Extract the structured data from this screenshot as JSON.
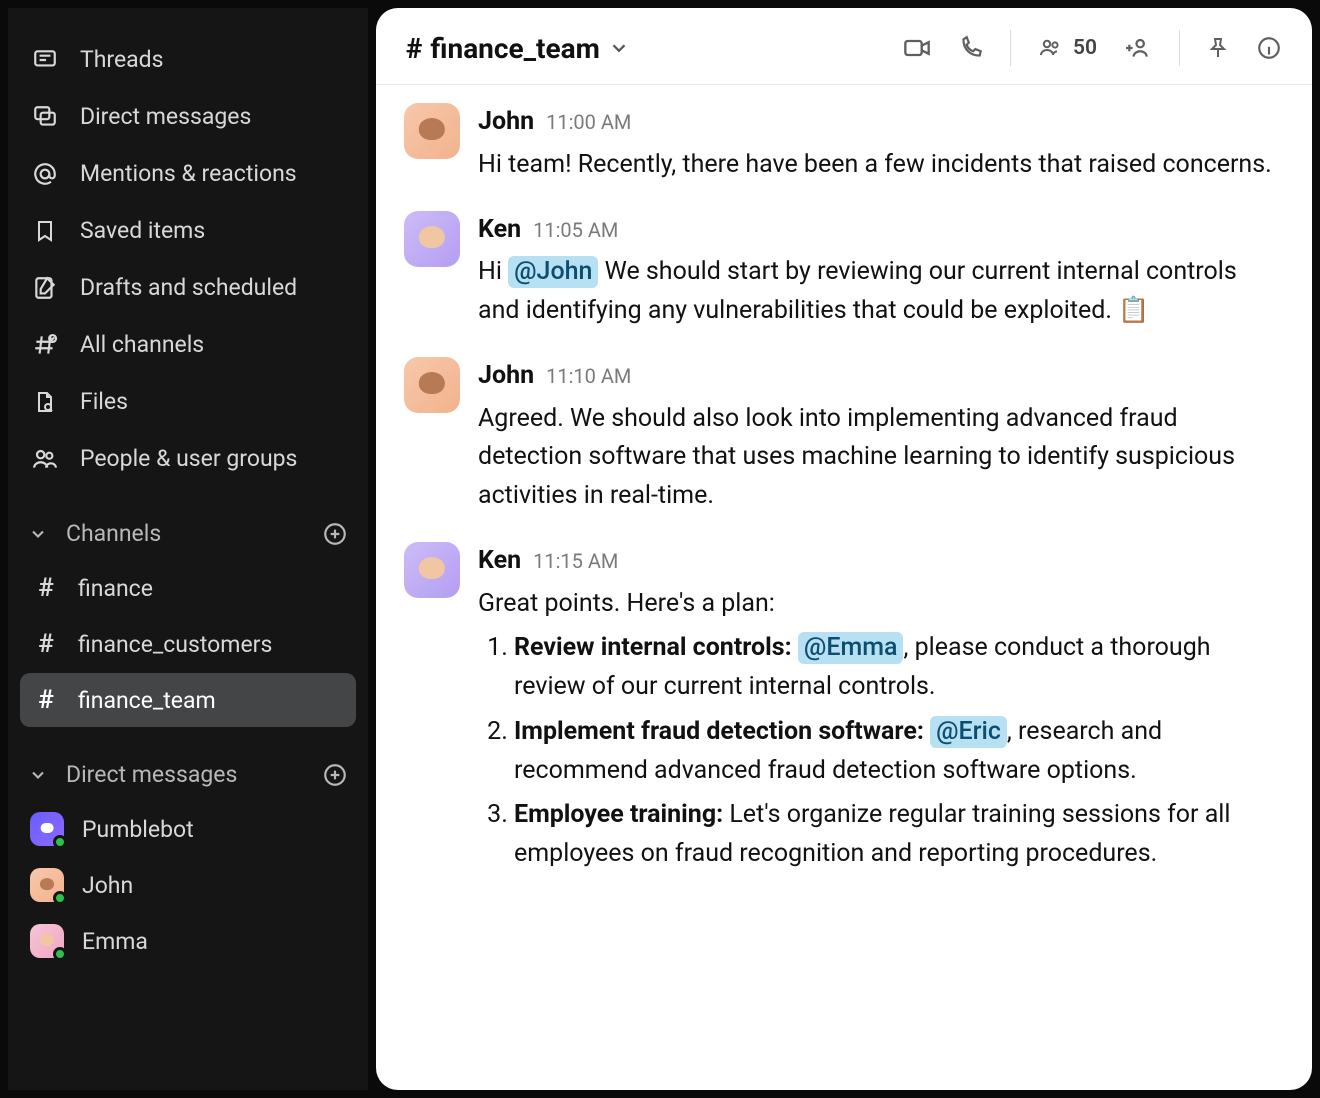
{
  "sidebar": {
    "nav": [
      {
        "icon": "thread-icon",
        "label": "Threads"
      },
      {
        "icon": "dm-icon",
        "label": "Direct messages"
      },
      {
        "icon": "mention-icon",
        "label": "Mentions & reactions"
      },
      {
        "icon": "bookmark-icon",
        "label": "Saved items"
      },
      {
        "icon": "draft-icon",
        "label": "Drafts and scheduled"
      },
      {
        "icon": "all-channels-icon",
        "label": "All channels"
      },
      {
        "icon": "file-icon",
        "label": "Files"
      },
      {
        "icon": "people-icon",
        "label": "People & user groups"
      }
    ],
    "channelsHeader": "Channels",
    "channels": [
      {
        "name": "finance",
        "active": false
      },
      {
        "name": "finance_customers",
        "active": false
      },
      {
        "name": "finance_team",
        "active": true
      }
    ],
    "dmHeader": "Direct messages",
    "dms": [
      {
        "name": "Pumblebot",
        "avatar": "bot"
      },
      {
        "name": "John",
        "avatar": "john"
      },
      {
        "name": "Emma",
        "avatar": "emma"
      }
    ]
  },
  "channel": {
    "name": "finance_team",
    "memberCount": "50"
  },
  "messages": [
    {
      "author": "John",
      "avatar": "john",
      "time": "11:00 AM",
      "text": "Hi team! Recently, there have been a few incidents that raised concerns."
    },
    {
      "author": "Ken",
      "avatar": "ken",
      "time": "11:05 AM",
      "pre": "Hi ",
      "mention": "@John",
      "post": " We should start by reviewing our current internal controls and identifying any vulnerabilities that could be exploited. 📋"
    },
    {
      "author": "John",
      "avatar": "john",
      "time": "11:10 AM",
      "text": "Agreed. We should also look into implementing advanced fraud detection software that uses machine learning to identify suspicious activities in real-time."
    },
    {
      "author": "Ken",
      "avatar": "ken",
      "time": "11:15 AM",
      "intro": "Great points. Here's a plan:",
      "plan": [
        {
          "lead": "Review internal controls:",
          "mention": "@Emma",
          "rest": ", please conduct a thorough review of our current internal controls."
        },
        {
          "lead": "Implement fraud detection software:",
          "mention": "@Eric",
          "rest": ", research and recommend advanced fraud detection software options."
        },
        {
          "lead": "Employee training:",
          "rest": " Let's organize regular training sessions for all employees on fraud recognition and reporting procedures."
        }
      ]
    }
  ]
}
